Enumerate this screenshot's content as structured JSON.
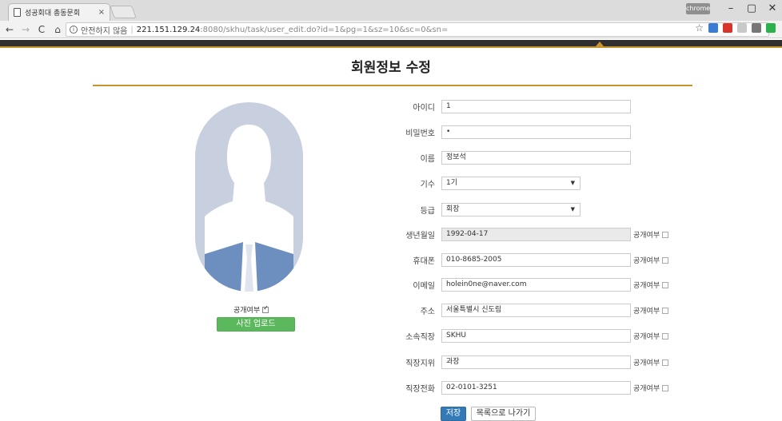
{
  "browser": {
    "tab_title": "성공회대 총동문회",
    "tab_close": "×",
    "profile_badge": "chrome",
    "security_label": "안전하지 않음",
    "separator": "|",
    "url_host": "221.151.129.24",
    "url_path": ":8080/skhu/task/user_edit.do?id=1&pg=1&sz=10&sc=0&sn=",
    "nav": {
      "back": "←",
      "forward": "→",
      "reload": "C",
      "home": "⌂"
    },
    "window": {
      "minimize": "–",
      "maximize": "▢",
      "close": "✕"
    },
    "star": "☆"
  },
  "page": {
    "title": "회원정보 수정",
    "photo_public_label": "공개여부",
    "upload_button": "사진 업로드",
    "public_label": "공개여부"
  },
  "form": {
    "fields": [
      {
        "label": "아이디",
        "value": "1"
      },
      {
        "label": "비밀번호",
        "value": "•"
      },
      {
        "label": "이름",
        "value": "정보석"
      },
      {
        "label": "기수",
        "value": "1기"
      },
      {
        "label": "등급",
        "value": "회장"
      },
      {
        "label": "생년월일",
        "value": "1992-04-17"
      },
      {
        "label": "휴대폰",
        "value": "010-8685-2005"
      },
      {
        "label": "이메일",
        "value": "holein0ne@naver.com"
      },
      {
        "label": "주소",
        "value": "서울특별시 신도림"
      },
      {
        "label": "소속직장",
        "value": "SKHU"
      },
      {
        "label": "직장지위",
        "value": "과장"
      },
      {
        "label": "직장전화",
        "value": "02-0101-3251"
      }
    ],
    "select_arrow": "▼"
  },
  "buttons": {
    "save": "저장",
    "back": "목록으로 나가기"
  },
  "colors": {
    "accent": "#c79530",
    "save": "#337ab7",
    "upload": "#5cb85c",
    "avatar_bg": "#c8d0e0",
    "avatar_fg": "#ffffff",
    "suit": "#6d8fc0"
  }
}
